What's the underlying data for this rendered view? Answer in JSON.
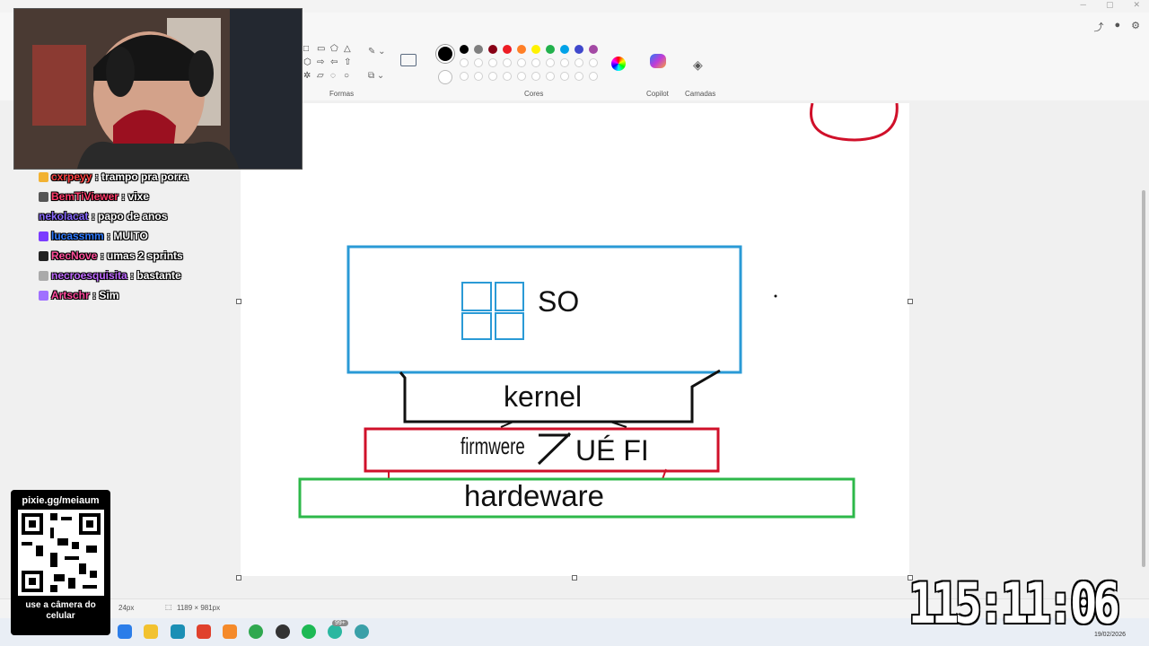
{
  "toolbar": {
    "groups": {
      "shapes": "Formas",
      "colors": "Cores",
      "copilot": "Copilot",
      "layers": "Camadas"
    },
    "current_color": "#000000",
    "secondary_color": "#ffffff",
    "palette": [
      "#000000",
      "#7f7f7f",
      "#880015",
      "#ed1c24",
      "#ff7f27",
      "#fff200",
      "#22b14c",
      "#00a2e8",
      "#3f48cc",
      "#a349a4",
      "#ffffff",
      "#c3c3c3",
      "#b97a57",
      "#ffaec9",
      "#ffc90e",
      "#efe4b0",
      "#b5e61d",
      "#99d9ea",
      "#7092be",
      "#c8bfe7"
    ]
  },
  "drawing": {
    "os_label": "SO",
    "kernel_label": "kernel",
    "firmware_label": "firmwere",
    "firmware_label2": "UÉ FI",
    "hardware_label": "hardeware"
  },
  "statusbar": {
    "brush_size": "24px",
    "canvas_size": "1189 × 981px"
  },
  "chat": [
    {
      "user": "cxrpeyy",
      "message": "trampo pra porra",
      "color": "#ff4040"
    },
    {
      "user": "BemTiViewer",
      "message": "vixe",
      "color": "#ff3b6b"
    },
    {
      "user": "nekolacat",
      "message": "papo de anos",
      "color": "#8a6bff"
    },
    {
      "user": "lucassmm",
      "message": "MUITO",
      "color": "#2f7bff"
    },
    {
      "user": "RecNove",
      "message": "umas 2 sprints",
      "color": "#ff4f9a"
    },
    {
      "user": "necroesquisita",
      "message": "bastante",
      "color": "#c06bff"
    },
    {
      "user": "Artschr",
      "message": "Sim",
      "color": "#ff4a9e"
    }
  ],
  "qr": {
    "url": "pixie.gg/meiaum",
    "caption": "use a câmera do celular"
  },
  "timer": "115:11:06",
  "taskbar": {
    "date": "19/02/2026",
    "notification_badge": "99+"
  }
}
